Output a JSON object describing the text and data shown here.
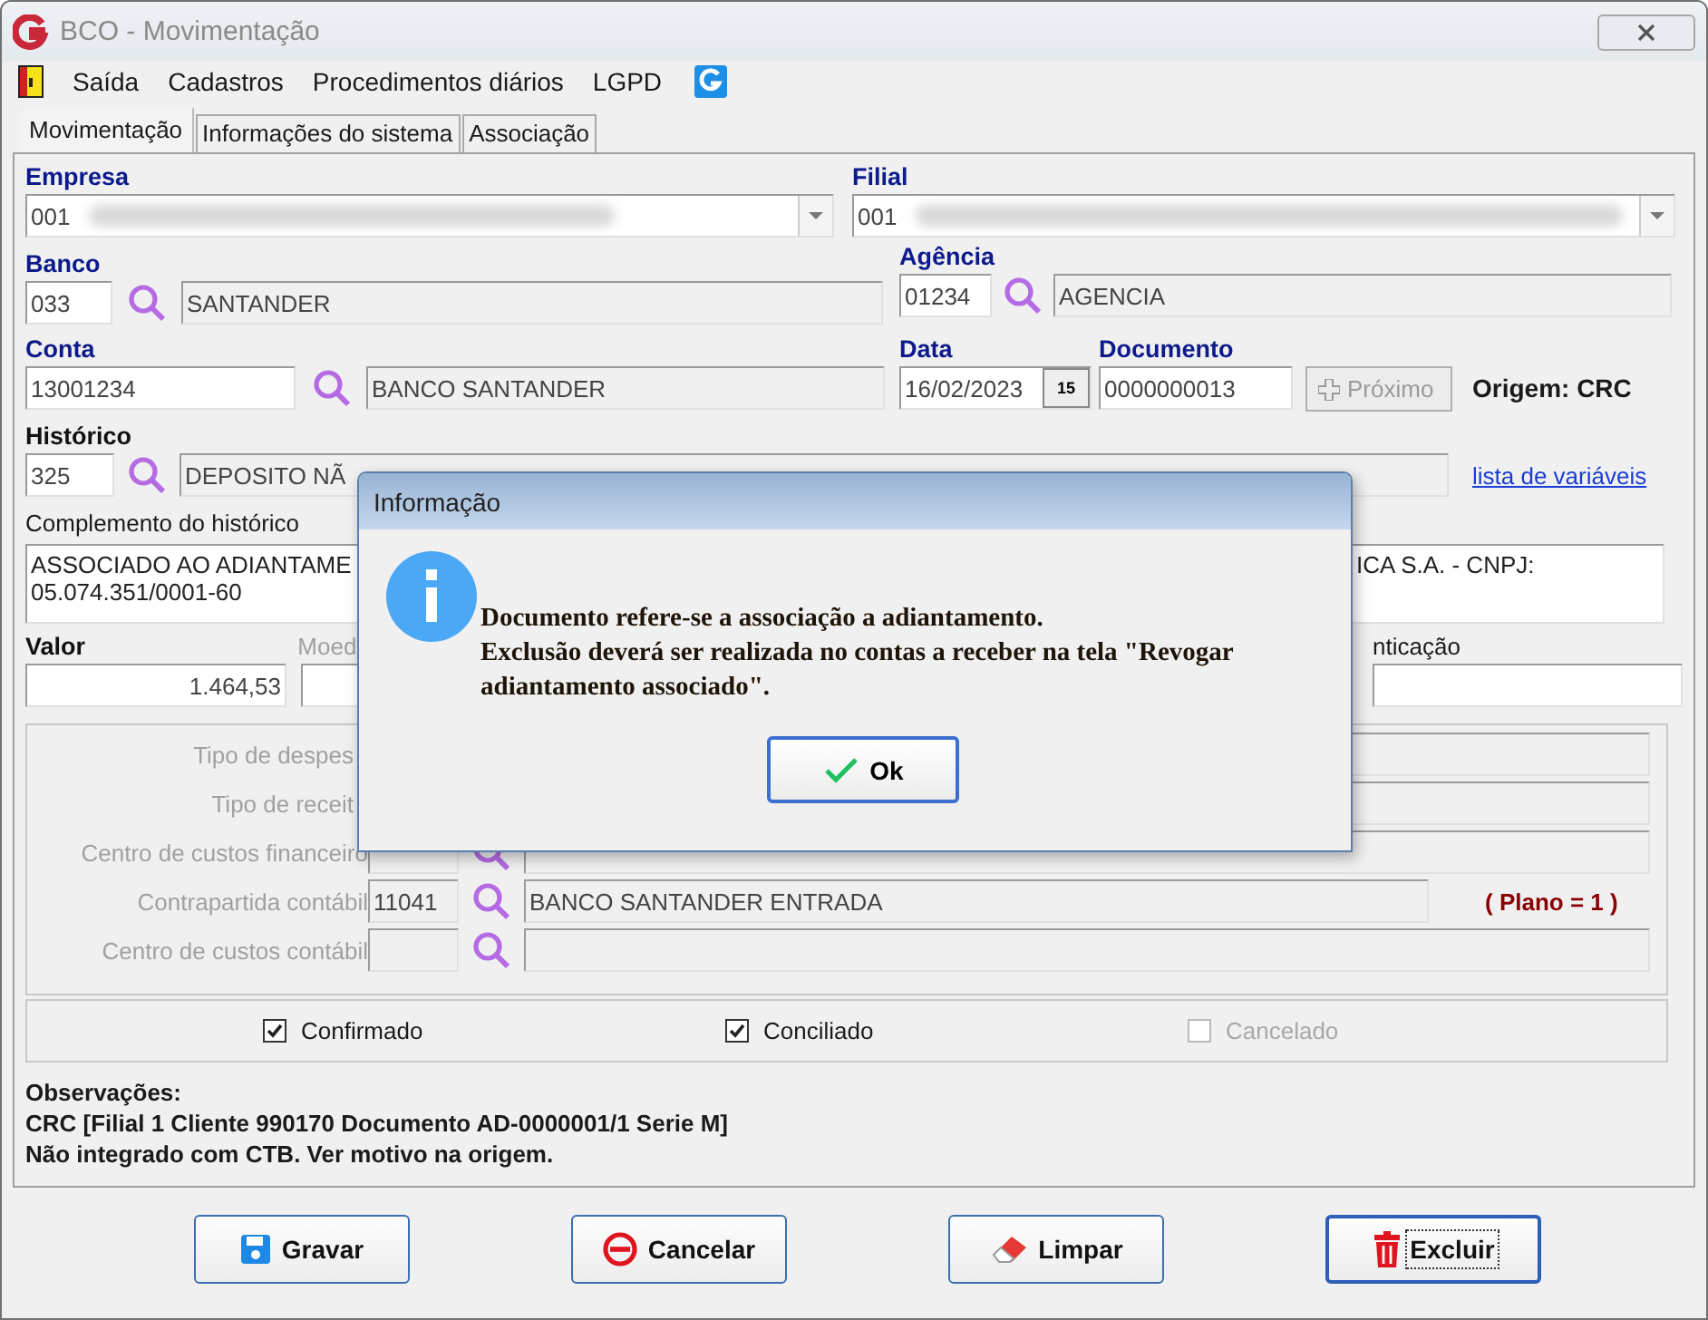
{
  "window": {
    "title": "BCO - Movimentação"
  },
  "menu": [
    "Saída",
    "Cadastros",
    "Procedimentos diários",
    "LGPD"
  ],
  "tabs": [
    {
      "label": "Movimentação",
      "selected": true
    },
    {
      "label": "Informações do sistema",
      "selected": false
    },
    {
      "label": "Associação",
      "selected": false
    }
  ],
  "form": {
    "empresa": {
      "label": "Empresa",
      "value": "001"
    },
    "filial": {
      "label": "Filial",
      "value": "001"
    },
    "banco": {
      "label": "Banco",
      "code": "033",
      "name": "SANTANDER"
    },
    "agencia": {
      "label": "Agência",
      "code": "01234",
      "name": "AGENCIA"
    },
    "conta": {
      "label": "Conta",
      "code": "13001234",
      "name": "BANCO SANTANDER"
    },
    "data": {
      "label": "Data",
      "value": "16/02/2023",
      "calendar_day": "15"
    },
    "documento": {
      "label": "Documento",
      "value": "0000000013"
    },
    "next_button": {
      "label": "Próximo",
      "disabled": true
    },
    "origem": "Origem: CRC",
    "historico": {
      "label": "Histórico",
      "code": "325",
      "name": "DEPOSITO NÃ"
    },
    "variables_link": "lista de variáveis",
    "complemento": {
      "label": "Complemento do histórico",
      "lines": [
        "ASSOCIADO AO ADIANTAME",
        "05.074.351/0001-60"
      ],
      "right_fragment": "ICA S.A. - CNPJ:"
    },
    "valor": {
      "label": "Valor",
      "value": "1.464,53"
    },
    "moeda_label": "Moed",
    "autenticacao_label": "nticação"
  },
  "accounting": [
    {
      "label": "Tipo de despes",
      "kind": "plain"
    },
    {
      "label": "Tipo de receit",
      "kind": "plain"
    },
    {
      "label": "Centro de custos financeiro",
      "kind": "lookup"
    },
    {
      "label": "Contrapartida contábil",
      "kind": "lookup",
      "code": "11041",
      "name": "BANCO SANTANDER ENTRADA",
      "note": "( Plano = 1 )"
    },
    {
      "label": "Centro de custos contábil",
      "kind": "lookup"
    }
  ],
  "flags": [
    {
      "label": "Confirmado",
      "checked": true,
      "disabled": false
    },
    {
      "label": "Conciliado",
      "checked": true,
      "disabled": false
    },
    {
      "label": "Cancelado",
      "checked": false,
      "disabled": true
    }
  ],
  "observations": [
    "Observações:",
    "CRC [Filial 1 Cliente 990170 Documento AD-0000001/1 Serie M]",
    "Não integrado com CTB. Ver motivo na origem."
  ],
  "buttons": [
    {
      "label": "Gravar",
      "kind": "save",
      "focused": false
    },
    {
      "label": "Cancelar",
      "kind": "cancel",
      "focused": false
    },
    {
      "label": "Limpar",
      "kind": "clear",
      "focused": false
    },
    {
      "label": "Excluir",
      "kind": "delete",
      "focused": true
    }
  ],
  "dialog": {
    "title": "Informação",
    "paragraphs": [
      "Documento refere-se a associação a adiantamento.",
      "Exclusão deverá ser realizada no contas a receber na tela \"Revogar adiantamento associado\"."
    ],
    "button": "Ok"
  }
}
